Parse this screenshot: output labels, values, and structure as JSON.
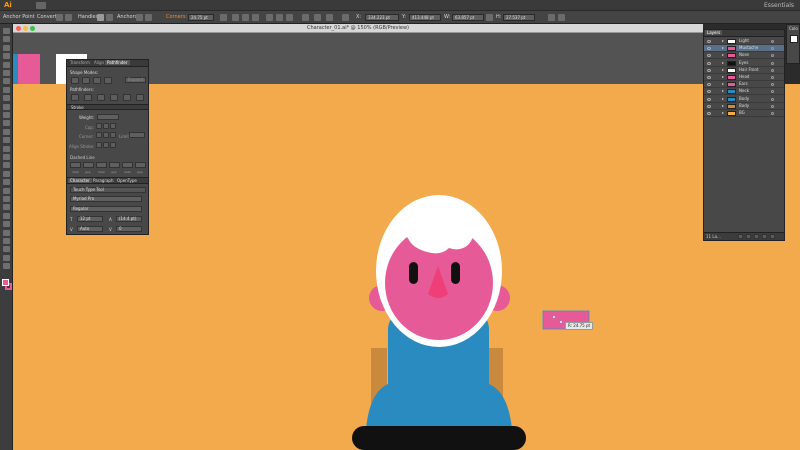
{
  "app": {
    "logo": "Ai",
    "workspace": "Essentials"
  },
  "control_bar": {
    "tool_name": "Anchor Point",
    "convert_label": "Convert:",
    "handles_label": "Handles:",
    "anchors_label": "Anchors:",
    "corners_label": "Corners:",
    "corner_value": "24.75 pt",
    "x_label": "X:",
    "x_value": "334.223 pt",
    "y_label": "Y:",
    "y_value": "413.448 pt",
    "w_label": "W:",
    "w_value": "63.857 pt",
    "h_label": "H:",
    "h_value": "27.537 pt"
  },
  "document": {
    "title": "Character_01.ai* @ 150% (RGB/Preview)"
  },
  "pathfinder_panel": {
    "tabs": [
      "Transform",
      "Align",
      "Pathfinder"
    ],
    "active_tab": "Pathfinder",
    "shape_modes_label": "Shape Modes:",
    "expand_label": "Expand",
    "pathfinders_label": "Pathfinders:"
  },
  "stroke_panel": {
    "title": "Stroke",
    "weight_label": "Weight:",
    "cap_label": "Cap:",
    "corner_label": "Corner:",
    "limit_label": "Limit:",
    "align_label": "Align Stroke:",
    "dashed_label": "Dashed Line",
    "dash_labels": [
      "dash",
      "gap",
      "dash",
      "gap",
      "dash",
      "gap"
    ]
  },
  "character_panel": {
    "tabs": [
      "Character",
      "Paragraph",
      "OpenType"
    ],
    "active_tab": "Character",
    "search_placeholder": "Touch Type Tool",
    "font_family": "Myriad Pro",
    "font_style": "Regular",
    "font_size": "12 pt",
    "leading": "(14.4 pt)",
    "kerning": "Auto",
    "tracking": "0"
  },
  "layers_panel": {
    "title": "Layers",
    "layers": [
      {
        "name": "Light",
        "selected": false
      },
      {
        "name": "Mustache",
        "selected": true
      },
      {
        "name": "Nose",
        "selected": false
      },
      {
        "name": "Eyes",
        "selected": false
      },
      {
        "name": "Hair Front",
        "selected": false
      },
      {
        "name": "Head",
        "selected": false
      },
      {
        "name": "Ears",
        "selected": false
      },
      {
        "name": "Neck",
        "selected": false
      },
      {
        "name": "Body",
        "selected": false
      },
      {
        "name": "Body",
        "selected": false
      },
      {
        "name": "BG",
        "selected": false
      }
    ],
    "count_label": "11 La..."
  },
  "color_panel": {
    "title": "Colo"
  },
  "tooltip": {
    "text": "R: 24.75 pt"
  },
  "colors": {
    "artboard": "#f2aa4c",
    "skin": "#e65a98",
    "hair": "#ffffff",
    "shirt": "#2a8bc0",
    "chair": "#c98a3e",
    "table": "#111111",
    "accent": "#ff8a1f"
  }
}
